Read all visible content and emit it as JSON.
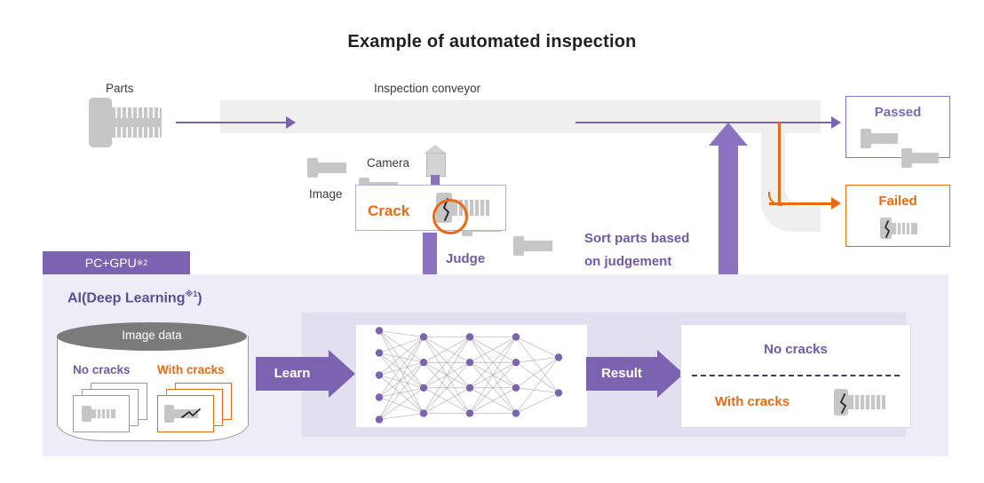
{
  "title": "Example of automated inspection",
  "labels": {
    "parts": "Parts",
    "inspection_conveyor": "Inspection conveyor",
    "camera": "Camera",
    "image": "Image"
  },
  "image_box": {
    "crack_label": "Crack",
    "icon": "cracked-bolt-icon",
    "highlight_color": "#ea6a11"
  },
  "flow": {
    "judge_label": "Judge",
    "learn_label": "Learn",
    "result_label": "Result",
    "sort_text_line1": "Sort parts based",
    "sort_text_line2": "on judgement"
  },
  "outcomes": {
    "passed": {
      "label": "Passed",
      "color": "#7b6bb0",
      "bolt_count": 2
    },
    "failed": {
      "label": "Failed",
      "color": "#ea6a11",
      "bolt_count": 1
    }
  },
  "ai": {
    "badge_label": "PC+GPU",
    "badge_footnote": "※2",
    "panel_title": "AI(Deep Learning",
    "panel_title_footnote": "※1",
    "panel_title_suffix": ")",
    "database": {
      "top_label": "Image data",
      "groups": [
        {
          "label": "No cracks",
          "color": "#6e5aa6",
          "cards": 3
        },
        {
          "label": "With cracks",
          "color": "#ea6a11",
          "cards": 3
        }
      ]
    },
    "network": {
      "layer_node_counts": [
        5,
        4,
        4,
        4,
        2
      ],
      "node_color": "#7b63b0",
      "edge_color": "#9a9a9a"
    },
    "result_box": {
      "no_cracks_label": "No cracks",
      "no_cracks_color": "#6e5aa6",
      "with_cracks_label": "With cracks",
      "with_cracks_color": "#ea6a11"
    }
  },
  "colors": {
    "purple": "#7b63b0",
    "purple_dark": "#5c4f96",
    "orange": "#ea6a11",
    "conveyor_gray": "#efeff0",
    "bolt_gray": "#c6c6c6",
    "panel_bg": "#eeecf6",
    "panel_inner_bg": "#e2dff0"
  }
}
